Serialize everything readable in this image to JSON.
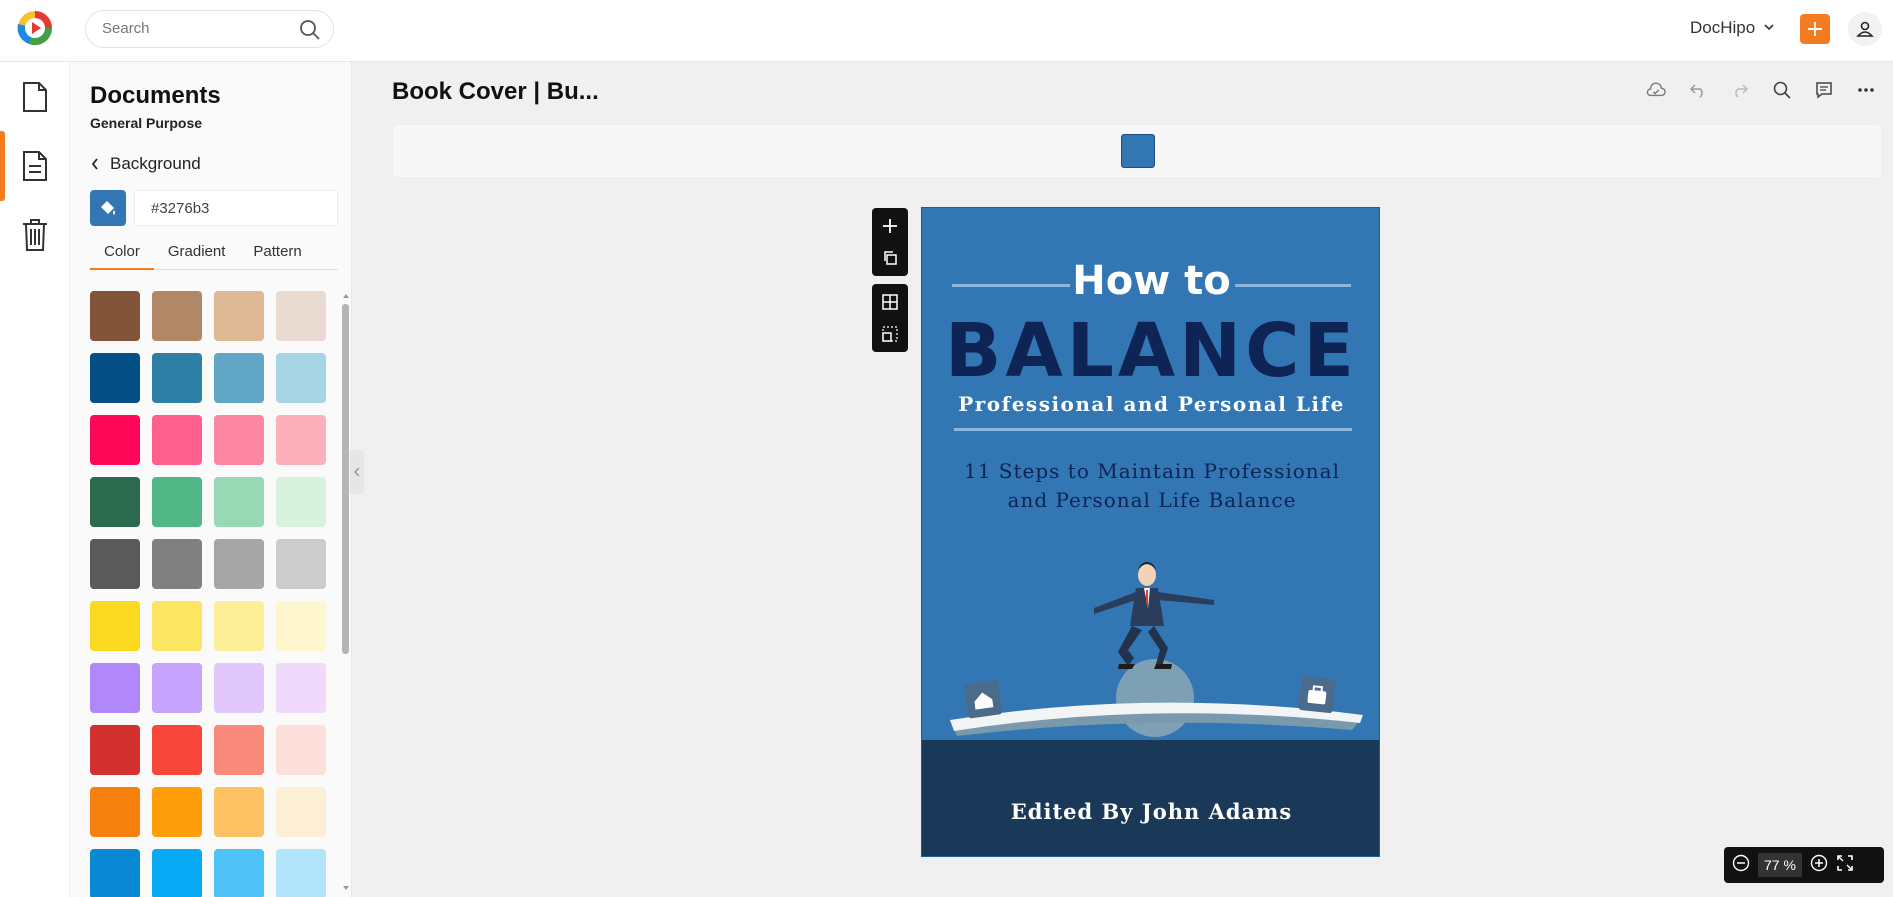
{
  "topbar": {
    "search_placeholder": "Search",
    "account_label": "DocHipo"
  },
  "panel": {
    "title": "Documents",
    "subtitle": "General Purpose",
    "back_label": "Background",
    "hex_value": "#3276b3",
    "tabs": [
      {
        "label": "Color",
        "active": true
      },
      {
        "label": "Gradient",
        "active": false
      },
      {
        "label": "Pattern",
        "active": false
      }
    ],
    "swatch_rows": [
      [
        "#82553a",
        "#b08868",
        "#dfb995",
        "#eadbd2"
      ],
      [
        "#054f87",
        "#2e7fa6",
        "#62a6c6",
        "#a8d5e6"
      ],
      [
        "#fe0758",
        "#fe5f8f",
        "#fd87a3",
        "#fbb0bc"
      ],
      [
        "#2c6a4f",
        "#52b787",
        "#98d8b4",
        "#d7f2dd"
      ],
      [
        "#5a5a5a",
        "#808080",
        "#a6a6a6",
        "#cccccc"
      ],
      [
        "#fad921",
        "#fde564",
        "#fdee98",
        "#fdf6cf"
      ],
      [
        "#b088fa",
        "#c6a3fc",
        "#e1c8fc",
        "#f0dafc"
      ],
      [
        "#d33130",
        "#f6473a",
        "#f98a7c",
        "#fde0dc"
      ],
      [
        "#f5800e",
        "#fe9e0b",
        "#fdc263",
        "#fdefd6"
      ],
      [
        "#0a88d3",
        "#07a9f4",
        "#4fc2f7",
        "#b2e5fb"
      ]
    ]
  },
  "document": {
    "title": "Book Cover | Bu...",
    "background_color": "#3276b3"
  },
  "cover": {
    "how_to": "How to",
    "balance": "BALANCE",
    "subtitle": "Professional and Personal Life",
    "steps_line1": "11 Steps to Maintain Professional",
    "steps_line2": "and Personal Life Balance",
    "edited_by": "Edited By John Adams"
  },
  "zoom": {
    "value": "77",
    "unit": "%"
  },
  "colors": {
    "accent": "#f47b20",
    "cover_bg": "#3276b3",
    "cover_bottom": "#1a3858",
    "title_dark": "#0e2455"
  }
}
